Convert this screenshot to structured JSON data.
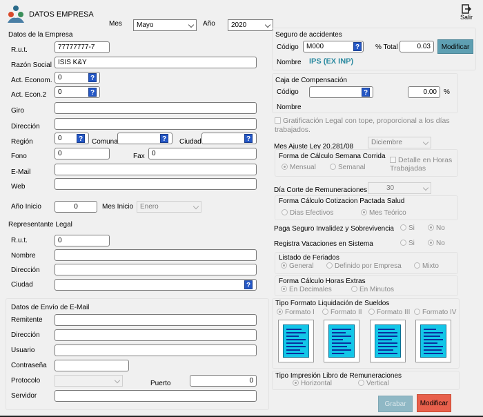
{
  "app": {
    "title": "DATOS EMPRESA",
    "exit_label": "Salir"
  },
  "period": {
    "mes_label": "Mes",
    "mes_value": "Mayo",
    "ano_label": "Año",
    "ano_value": "2020"
  },
  "empresa": {
    "section_title": "Datos de la Empresa",
    "rut_label": "R.u.t.",
    "rut_value": "77777777-7",
    "razon_label": "Razón Social",
    "razon_value": "ISIS K&Y",
    "act1_label": "Act. Econom.",
    "act1_value": "0",
    "act2_label": "Act. Econ.2",
    "act2_value": "0",
    "giro_label": "Giro",
    "direccion_label": "Dirección",
    "region_label": "Región",
    "region_value": "0",
    "comuna_label": "Comuna",
    "ciudad_label": "Ciudad",
    "fono_label": "Fono",
    "fono_value": "0",
    "fax_label": "Fax",
    "fax_value": "0",
    "email_label": "E-Mail",
    "web_label": "Web",
    "ano_inicio_label": "Año Inicio",
    "ano_inicio_value": "0",
    "mes_inicio_label": "Mes Inicio",
    "mes_inicio_value": "Enero"
  },
  "representante": {
    "section_title": "Representante Legal",
    "rut_label": "R.u.t.",
    "rut_value": "0",
    "nombre_label": "Nombre",
    "direccion_label": "Dirección",
    "ciudad_label": "Ciudad"
  },
  "email_envio": {
    "section_title": "Datos de Envío de E-Mail",
    "remitente_label": "Remitente",
    "direccion_label": "Dirección",
    "usuario_label": "Usuario",
    "contrasena_label": "Contraseña",
    "protocolo_label": "Protocolo",
    "puerto_label": "Puerto",
    "puerto_value": "0",
    "servidor_label": "Servidor"
  },
  "seguro": {
    "section_title": "Seguro de accidentes",
    "codigo_label": "Código",
    "codigo_value": "M000",
    "pct_label": "% Total",
    "pct_value": "0.03",
    "modificar_label": "Modificar",
    "nombre_label": "Nombre",
    "nombre_value": "IPS (EX INP)"
  },
  "caja": {
    "section_title": "Caja de Compensación",
    "codigo_label": "Código",
    "pct_value": "0.00",
    "pct_symbol": "%",
    "nombre_label": "Nombre"
  },
  "gratificacion": {
    "label": "Gratificación Legal con tope, proporcional a los días trabajados."
  },
  "ajuste": {
    "label": "Mes Ajuste Ley 20.281/08",
    "value": "Diciembre",
    "forma_title": "Forma de Cálculo Semana Corrida",
    "opt_mensual": "Mensual",
    "opt_semanal": "Semanal",
    "detalle_label": "Detalle en Horas Trabajadas"
  },
  "corte": {
    "label": "Día Corte de Remuneraciones",
    "value": "30",
    "forma_title": "Forma Cálculo Cotizacion Pactada Salud",
    "opt_dias": "Dias Efectivos",
    "opt_mes": "Mes Teórico"
  },
  "paga_seguro": {
    "label": "Paga Seguro Invalidez y Sobrevivencia",
    "si": "Si",
    "no": "No"
  },
  "registra_vac": {
    "label": "Registra Vacaciones en Sistema",
    "si": "Si",
    "no": "No"
  },
  "feriados": {
    "title": "Listado de Feriados",
    "opt_general": "General",
    "opt_definido": "Definido por Empresa",
    "opt_mixto": "Mixto"
  },
  "horas_extras": {
    "title": "Forma Cálculo Horas Extras",
    "opt_decimales": "En Decimales",
    "opt_minutos": "En Minutos"
  },
  "formato": {
    "title": "Tipo Formato Liquidación de Sueldos",
    "options": [
      "Formato I",
      "Formato II",
      "Formato III",
      "Formato IV"
    ]
  },
  "libro": {
    "title": "Tipo Impresión Libro de Remuneraciones",
    "opt_horizontal": "Horizontal",
    "opt_vertical": "Vertical"
  },
  "actions": {
    "grabar_label": "Grabar",
    "modificar_label": "Modificar"
  },
  "colors": {
    "accent_teal": "#5e9fb2",
    "modificar_red": "#e8604c",
    "help_blue": "#2457c5",
    "text_teal": "#2b8aa0"
  },
  "icons": {
    "logo": "people-group-icon",
    "exit": "exit-door-icon",
    "help": "question-icon",
    "format": "document-icon"
  }
}
